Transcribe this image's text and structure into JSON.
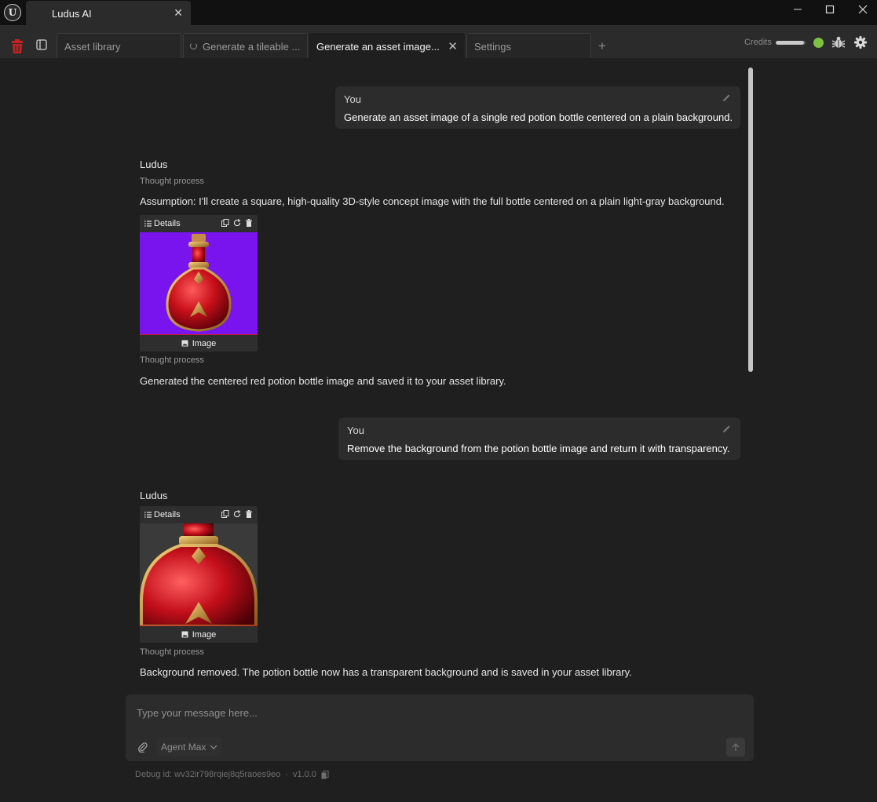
{
  "window": {
    "tab_title": "Ludus AI",
    "close_glyph": "✕",
    "controls": {
      "minimize": "─",
      "maximize": "☐",
      "close": "✕"
    }
  },
  "toolbar": {
    "tabs": [
      {
        "label": "Asset library"
      },
      {
        "label": "Generate a tileable ..."
      },
      {
        "label": "Generate an asset image..."
      },
      {
        "label": "Settings"
      }
    ],
    "active_tab_close": "✕",
    "new_tab": "+",
    "credits_label": "Credits",
    "credits_level": 0.95,
    "status_color": "#7cc242"
  },
  "chat": {
    "messages": [
      {
        "role": "user",
        "author": "You",
        "text": "Generate an asset image of a single red potion bottle centered on a plain background."
      },
      {
        "role": "assistant",
        "author": "Ludus",
        "thought_before": "Thought process",
        "pre_text": "Assumption: I'll create a square, high-quality 3D-style concept image with the full bottle centered on a plain light-gray background.",
        "card": {
          "details": "Details",
          "footer": "Image",
          "image": "red-potion-bottle-purple-background"
        },
        "thought_after": "Thought process",
        "text": "Generated the centered red potion bottle image and saved it to your asset library."
      },
      {
        "role": "user",
        "author": "You",
        "text": "Remove the background from the potion bottle image and return it with transparency."
      },
      {
        "role": "assistant",
        "author": "Ludus",
        "card": {
          "details": "Details",
          "footer": "Image",
          "image": "red-potion-bottle-transparent-closeup"
        },
        "thought_after": "Thought process",
        "text": "Background removed. The potion bottle now has a transparent background and is saved in your asset library."
      }
    ]
  },
  "composer": {
    "placeholder": "Type your message here...",
    "agent_mode": "Agent Max"
  },
  "footer": {
    "debug_id": "Debug id: wv32ir798rqiej8q5raoes9eo",
    "separator": "·",
    "version": "v1.0.0"
  },
  "colors": {
    "background": "#1f1f1f",
    "titlebar": "#111111",
    "toolbar": "#2b2b2b",
    "message_bubble": "#2c2c2c",
    "accent_red": "#cc1f1f",
    "image_bg_purple": "#7a14ee"
  }
}
